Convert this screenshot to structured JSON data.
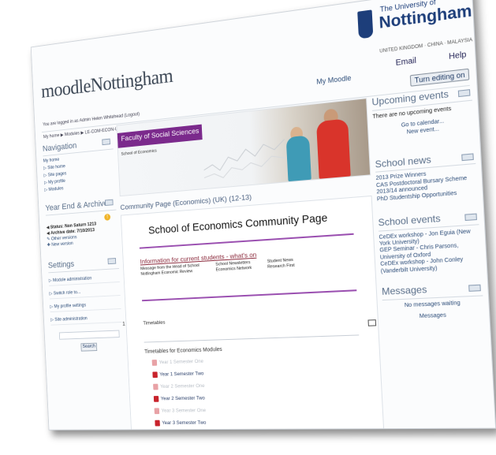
{
  "header": {
    "logo_prefix": "moodle",
    "logo_name": "Nottingham",
    "university_small": "The University of",
    "university_name": "Nottingham",
    "university_countries": "UNITED KINGDOM · CHINA · MALAYSIA",
    "my_moodle": "My Moodle",
    "email": "Email",
    "help": "Help",
    "turn_editing": "Turn editing on",
    "logged_in": "You are logged in as Admin Helen Whitehead (Logout)",
    "breadcrumb": "My home ▶ Modules ▶ LE-COM-ECON-UK-1213"
  },
  "navigation": {
    "title": "Navigation",
    "items": [
      "My home",
      "Site home",
      "Site pages",
      "My profile",
      "Modules"
    ]
  },
  "archive": {
    "title": "Year End & Archive",
    "status": "Status: Non Saturn 1213",
    "archive_date": "Archive date: 7/10/2013",
    "other_versions": "Other versions",
    "new_version": "New version"
  },
  "settings": {
    "title": "Settings",
    "items": [
      "Module administration",
      "Switch role to...",
      "My profile settings",
      "Site administration"
    ],
    "search_label": "Search"
  },
  "banner": {
    "faculty": "Faculty of Social Sciences",
    "school": "School of Economics"
  },
  "main": {
    "community_title": "Community Page (Economics) (UK) (12-13)",
    "page_heading": "School of Economics Community Page",
    "info_link": "Information for current students - what's on",
    "info_rows": [
      [
        "Message from the Head of School",
        "School Newsletters",
        "Student News"
      ],
      [
        "Nottingham Economic Review",
        "Economics Network",
        "Research First"
      ]
    ],
    "section_number": "1",
    "timetables_label": "Timetables",
    "timetables_heading": "Timetables for Economics Modules",
    "files": [
      "Year 1 Semester One",
      "Year 1 Semester Two",
      "Year 2 Semester One",
      "Year 2 Semester Two",
      "Year 3 Semester One",
      "Year 3 Semester Two"
    ]
  },
  "sidebar_right": {
    "upcoming_title": "Upcoming events",
    "upcoming_text": "There are no upcoming events",
    "go_to_calendar": "Go to calendar...",
    "new_event": "New event...",
    "news_title": "School news",
    "news_items": [
      "2013 Prize Winners",
      "CAS Postdoctoral Bursary Scheme 2013/14 announced",
      "PhD Studentship Opportunities"
    ],
    "events_title": "School events",
    "events_items": [
      "CeDEx workshop - Jon Eguia (New York University)",
      "GEP Seminar - Chris Parsons, University of Oxford",
      "CeDEx workshop - John Conley (Vanderbilt University)"
    ],
    "messages_title": "Messages",
    "messages_text": "No messages waiting",
    "messages_link": "Messages"
  }
}
